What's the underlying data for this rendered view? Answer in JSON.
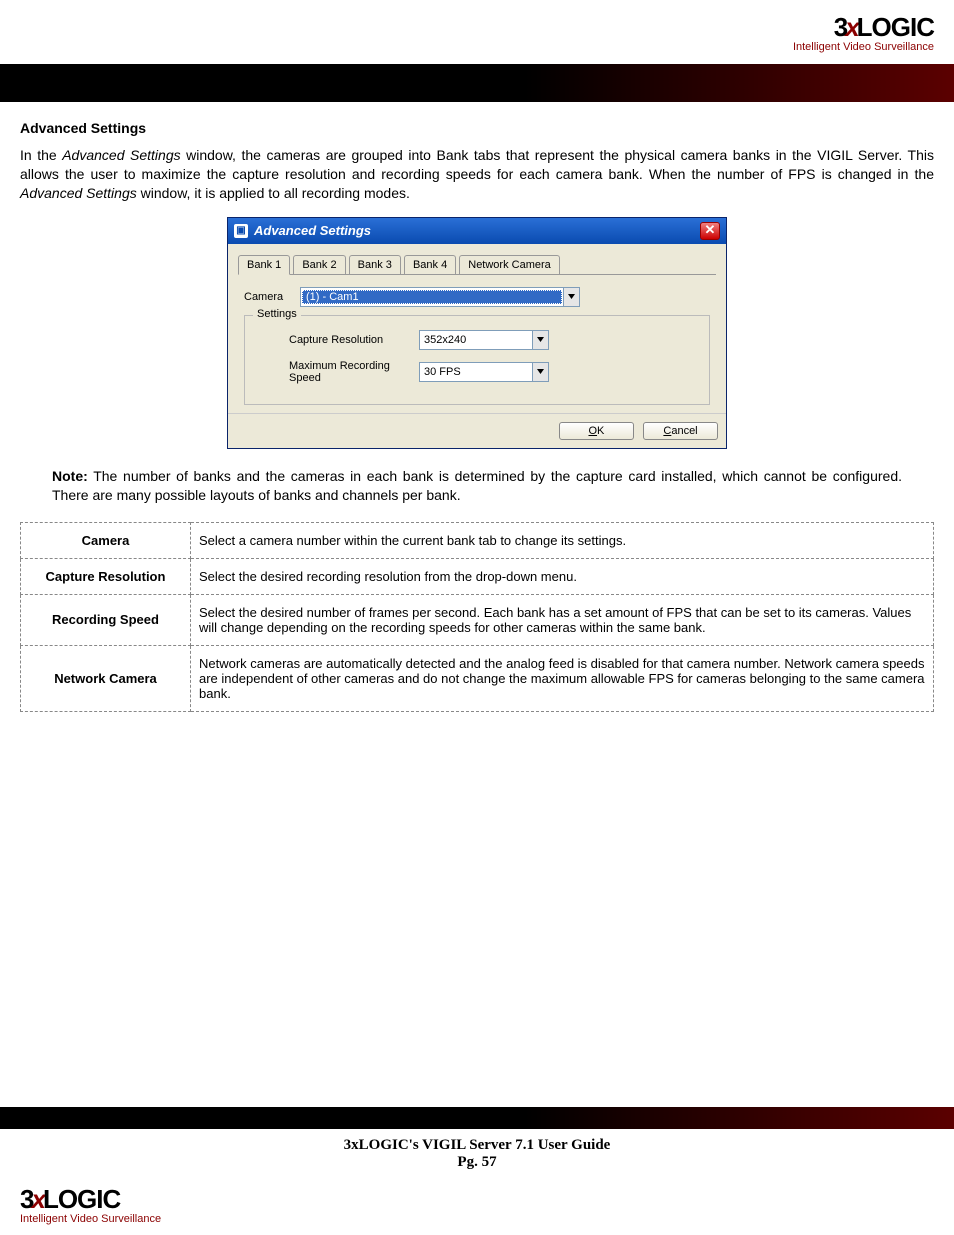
{
  "brand": {
    "name_prefix": "3",
    "name_x": "x",
    "name_suffix": "LOGIC",
    "tagline": "Intelligent Video Surveillance"
  },
  "section": {
    "title": "Advanced Settings",
    "intro_1": "In the ",
    "intro_ital1": "Advanced Settings",
    "intro_2": " window, the cameras are grouped into Bank tabs that represent the physical camera banks in the VIGIL Server. This allows the user to maximize the capture resolution and recording speeds for each camera bank. When the number of FPS is changed in the ",
    "intro_ital2": "Advanced Settings",
    "intro_3": " window, it is applied to all recording modes."
  },
  "dialog": {
    "title": "Advanced Settings",
    "tabs": [
      "Bank 1",
      "Bank 2",
      "Bank 3",
      "Bank 4",
      "Network Camera"
    ],
    "camera_label": "Camera",
    "camera_value": "(1) - Cam1",
    "fieldset_legend": "Settings",
    "capture_label": "Capture Resolution",
    "capture_value": "352x240",
    "speed_label": "Maximum Recording Speed",
    "speed_value": "30 FPS",
    "ok_button": "OK",
    "cancel_button": "Cancel",
    "ok_u": "O",
    "ok_rest": "K",
    "cancel_u": "C",
    "cancel_rest": "ancel"
  },
  "note": {
    "label": "Note:",
    "text": " The number of banks and the cameras in each bank is determined by the capture card installed, which cannot be configured. There are many possible layouts of banks and channels per bank."
  },
  "definitions": [
    {
      "term": "Camera",
      "desc": "Select a camera number within the current bank tab to change its settings."
    },
    {
      "term": "Capture Resolution",
      "desc": "Select the desired recording resolution from the drop-down menu."
    },
    {
      "term": "Recording Speed",
      "desc": "Select the desired number of frames per second. Each bank has a set amount of FPS that can be set to its cameras. Values will change depending on the recording speeds for other cameras within the same bank."
    },
    {
      "term": "Network Camera",
      "desc": "Network cameras are automatically detected and the analog feed is disabled for that camera number.  Network camera speeds are independent of other cameras and do not change the maximum allowable FPS for cameras belonging to the same camera bank."
    }
  ],
  "footer": {
    "guide": "3xLOGIC's VIGIL Server 7.1 User Guide",
    "page": "Pg. 57"
  }
}
